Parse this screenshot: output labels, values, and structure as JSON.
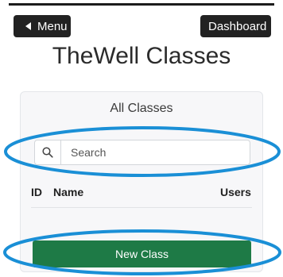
{
  "nav": {
    "menu_label": "Menu",
    "dashboard_label": "Dashboard"
  },
  "page": {
    "title": "TheWell Classes"
  },
  "card": {
    "title": "All Classes",
    "search": {
      "placeholder": "Search",
      "icon": "search-icon"
    },
    "table": {
      "columns": [
        "ID",
        "Name",
        "Users"
      ],
      "rows": []
    },
    "new_class_label": "New Class"
  },
  "colors": {
    "nav_button_bg": "#222222",
    "primary_green": "#1e7a46",
    "highlight_blue": "#1a8fd6"
  }
}
